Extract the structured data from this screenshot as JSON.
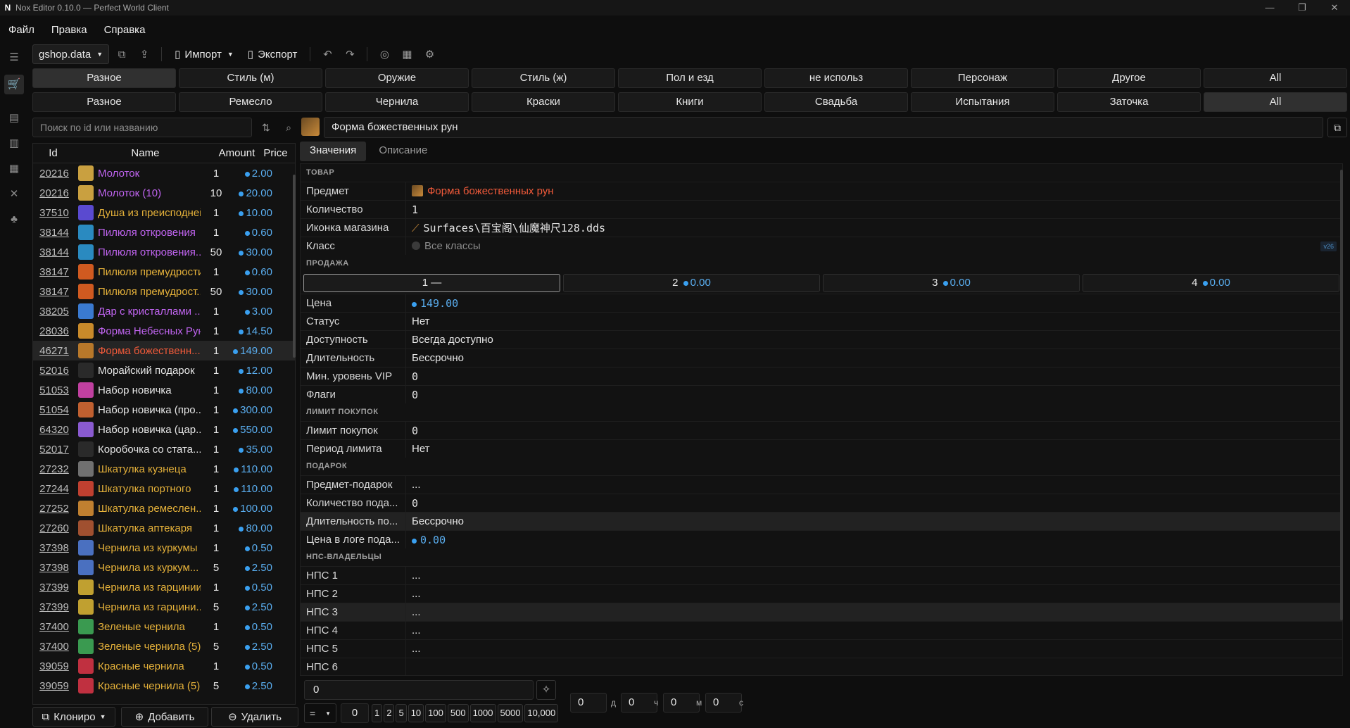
{
  "window": {
    "title": "Nox Editor 0.10.0 — Perfect World Client",
    "logo": "N"
  },
  "menu": [
    "Файл",
    "Правка",
    "Справка"
  ],
  "toolbar": {
    "file": "gshop.data",
    "import": "Импорт",
    "export": "Экспорт"
  },
  "categories_top": [
    "Разное",
    "Стиль (м)",
    "Оружие",
    "Стиль (ж)",
    "Пол и езд",
    "не использ",
    "Персонаж",
    "Другое",
    "All"
  ],
  "categories_bottom": [
    "Разное",
    "Ремесло",
    "Чернила",
    "Краски",
    "Книги",
    "Свадьба",
    "Испытания",
    "Заточка",
    "All"
  ],
  "search": {
    "placeholder": "Поиск по id или названию"
  },
  "list": {
    "headers": {
      "id": "Id",
      "name": "Name",
      "amount": "Amount",
      "price": "Price"
    },
    "rows": [
      {
        "id": "20216",
        "name": "Молоток",
        "amount": "1",
        "price": "2.00",
        "color": "#c064f0",
        "icon": "#c9a040"
      },
      {
        "id": "20216",
        "name": "Молоток (10)",
        "amount": "10",
        "price": "20.00",
        "color": "#c064f0",
        "icon": "#c9a040"
      },
      {
        "id": "37510",
        "name": "Душа из преисподней",
        "amount": "1",
        "price": "10.00",
        "color": "#e6b23a",
        "icon": "#5a4ad0"
      },
      {
        "id": "38144",
        "name": "Пилюля откровения",
        "amount": "1",
        "price": "0.60",
        "color": "#c064f0",
        "icon": "#2a8ac0"
      },
      {
        "id": "38144",
        "name": "Пилюля откровения...",
        "amount": "50",
        "price": "30.00",
        "color": "#c064f0",
        "icon": "#2a8ac0"
      },
      {
        "id": "38147",
        "name": "Пилюля премудрости",
        "amount": "1",
        "price": "0.60",
        "color": "#e6b23a",
        "icon": "#d05a20"
      },
      {
        "id": "38147",
        "name": "Пилюля премудрост...",
        "amount": "50",
        "price": "30.00",
        "color": "#e6b23a",
        "icon": "#d05a20"
      },
      {
        "id": "38205",
        "name": "Дар с кристаллами ...",
        "amount": "1",
        "price": "3.00",
        "color": "#c064f0",
        "icon": "#3a7ad0"
      },
      {
        "id": "28036",
        "name": "Форма Небесных Рун",
        "amount": "1",
        "price": "14.50",
        "color": "#c064f0",
        "icon": "#c88a2a"
      },
      {
        "id": "46271",
        "name": "Форма божественн...",
        "amount": "1",
        "price": "149.00",
        "color": "#f05a3a",
        "icon": "#b8782a",
        "selected": true
      },
      {
        "id": "52016",
        "name": "Морайский подарок",
        "amount": "1",
        "price": "12.00",
        "color": "#e6e6e6",
        "icon": "#2a2a2a"
      },
      {
        "id": "51053",
        "name": "Набор новичка",
        "amount": "1",
        "price": "80.00",
        "color": "#e6e6e6",
        "icon": "#c040a0"
      },
      {
        "id": "51054",
        "name": "Набор новичка (про...",
        "amount": "1",
        "price": "300.00",
        "color": "#e6e6e6",
        "icon": "#c06030"
      },
      {
        "id": "64320",
        "name": "Набор новичка (цар...",
        "amount": "1",
        "price": "550.00",
        "color": "#e6e6e6",
        "icon": "#8a5ad0"
      },
      {
        "id": "52017",
        "name": "Коробочка со стата...",
        "amount": "1",
        "price": "35.00",
        "color": "#e6e6e6",
        "icon": "#2a2a2a"
      },
      {
        "id": "27232",
        "name": "Шкатулка кузнеца",
        "amount": "1",
        "price": "110.00",
        "color": "#e6b23a",
        "icon": "#707070"
      },
      {
        "id": "27244",
        "name": "Шкатулка портного",
        "amount": "1",
        "price": "110.00",
        "color": "#e6b23a",
        "icon": "#c04030"
      },
      {
        "id": "27252",
        "name": "Шкатулка ремеслен...",
        "amount": "1",
        "price": "100.00",
        "color": "#e6b23a",
        "icon": "#c08030"
      },
      {
        "id": "27260",
        "name": "Шкатулка аптекаря",
        "amount": "1",
        "price": "80.00",
        "color": "#e6b23a",
        "icon": "#a05030"
      },
      {
        "id": "37398",
        "name": "Чернила из куркумы",
        "amount": "1",
        "price": "0.50",
        "color": "#e6b23a",
        "icon": "#4a70c0"
      },
      {
        "id": "37398",
        "name": "Чернила из куркум...",
        "amount": "5",
        "price": "2.50",
        "color": "#e6b23a",
        "icon": "#4a70c0"
      },
      {
        "id": "37399",
        "name": "Чернила из гарцинии",
        "amount": "1",
        "price": "0.50",
        "color": "#e6b23a",
        "icon": "#c0a030"
      },
      {
        "id": "37399",
        "name": "Чернила из гарцини...",
        "amount": "5",
        "price": "2.50",
        "color": "#e6b23a",
        "icon": "#c0a030"
      },
      {
        "id": "37400",
        "name": "Зеленые чернила",
        "amount": "1",
        "price": "0.50",
        "color": "#e6b23a",
        "icon": "#3a9a50"
      },
      {
        "id": "37400",
        "name": "Зеленые чернила (5)",
        "amount": "5",
        "price": "2.50",
        "color": "#e6b23a",
        "icon": "#3a9a50"
      },
      {
        "id": "39059",
        "name": "Красные чернила",
        "amount": "1",
        "price": "0.50",
        "color": "#e6b23a",
        "icon": "#c03040"
      },
      {
        "id": "39059",
        "name": "Красные чернила (5)",
        "amount": "5",
        "price": "2.50",
        "color": "#e6b23a",
        "icon": "#c03040"
      }
    ]
  },
  "bottom_buttons": {
    "clone": "Клониро",
    "add": "Добавить",
    "delete": "Удалить"
  },
  "detail": {
    "name": "Форма божественных рун",
    "tabs": [
      "Значения",
      "Описание"
    ],
    "section_goods": "ТОВАР",
    "item_label": "Предмет",
    "item_value": "Форма божественных рун",
    "qty_label": "Количество",
    "qty_value": "1",
    "shop_icon_label": "Иконка магазина",
    "shop_icon_value": "Surfaces\\百宝阁\\仙魔神尺128.dds",
    "class_label": "Класс",
    "class_value": "Все классы",
    "class_badge": "v26",
    "section_sale": "ПРОДАЖА",
    "sale_tabs": [
      {
        "num": "1",
        "value": "—"
      },
      {
        "num": "2",
        "value": "0.00"
      },
      {
        "num": "3",
        "value": "0.00"
      },
      {
        "num": "4",
        "value": "0.00"
      }
    ],
    "price_label": "Цена",
    "price_value": "149.00",
    "status_label": "Статус",
    "status_value": "Нет",
    "avail_label": "Доступность",
    "avail_value": "Всегда доступно",
    "duration_label": "Длительность",
    "duration_value": "Бессрочно",
    "vip_label": "Мин. уровень VIP",
    "vip_value": "0",
    "flags_label": "Флаги",
    "flags_value": "0",
    "section_limit": "ЛИМИТ ПОКУПОК",
    "limit_label": "Лимит покупок",
    "limit_value": "0",
    "period_label": "Период лимита",
    "period_value": "Нет",
    "section_gift": "ПОДАРОК",
    "gift_item_label": "Предмет-подарок",
    "gift_item_value": "...",
    "gift_qty_label": "Количество пода...",
    "gift_qty_value": "0",
    "gift_dur_label": "Длительность по...",
    "gift_dur_value": "Бессрочно",
    "gift_price_label": "Цена в логе пода...",
    "gift_price_value": "0.00",
    "section_npc": "НПС-ВЛАДЕЛЬЦЫ",
    "npcs": [
      {
        "label": "НПС 1",
        "value": "..."
      },
      {
        "label": "НПС 2",
        "value": "..."
      },
      {
        "label": "НПС 3",
        "value": "..."
      },
      {
        "label": "НПС 4",
        "value": "..."
      },
      {
        "label": "НПС 5",
        "value": "..."
      },
      {
        "label": "НПС 6",
        "value": ""
      }
    ]
  },
  "editor": {
    "value": "0",
    "days": "0",
    "days_unit": "д",
    "hours": "0",
    "hours_unit": "ч",
    "minutes": "0",
    "minutes_unit": "м",
    "seconds": "0",
    "seconds_unit": "с",
    "op": "=",
    "op_value": "0",
    "presets": [
      "1",
      "2",
      "5",
      "10",
      "100",
      "500",
      "1000",
      "5000",
      "10,000"
    ]
  }
}
